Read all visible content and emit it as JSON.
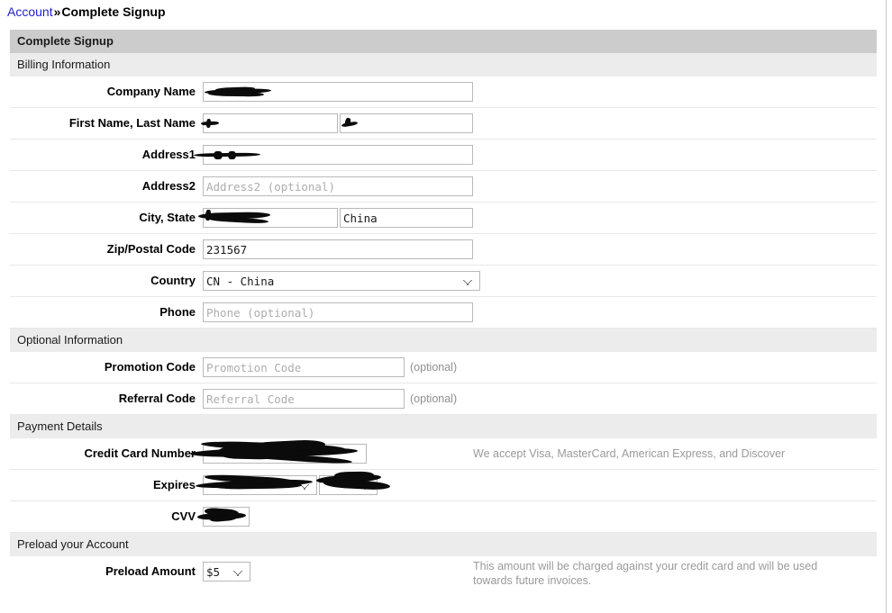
{
  "breadcrumb": {
    "parent": "Account",
    "separator": "»",
    "current": "Complete Signup"
  },
  "panel": {
    "title": "Complete Signup"
  },
  "sections": {
    "billing": "Billing Information",
    "optional": "Optional Information",
    "payment": "Payment Details",
    "preload": "Preload your Account"
  },
  "billing": {
    "company_label": "Company Name",
    "company_value": "",
    "name_label": "First Name, Last Name",
    "first_name_value": "",
    "last_name_value": "",
    "address1_label": "Address1",
    "address1_value": "",
    "address2_label": "Address2",
    "address2_placeholder": "Address2 (optional)",
    "address2_value": "",
    "city_state_label": "City, State",
    "city_value": "",
    "state_value": "China",
    "zip_label": "Zip/Postal Code",
    "zip_value": "231567",
    "country_label": "Country",
    "country_value": "CN - China",
    "phone_label": "Phone",
    "phone_placeholder": "Phone (optional)",
    "phone_value": ""
  },
  "optional": {
    "promotion_label": "Promotion Code",
    "promotion_placeholder": "Promotion Code",
    "promotion_value": "",
    "promotion_hint": "(optional)",
    "referral_label": "Referral Code",
    "referral_placeholder": "Referral Code",
    "referral_value": "",
    "referral_hint": "(optional)"
  },
  "payment": {
    "card_label": "Credit Card Number",
    "card_value": "",
    "card_hint": "We accept Visa, MasterCard, American Express, and Discover",
    "expires_label": "Expires",
    "expires_month_value": "",
    "expires_year_value": "",
    "cvv_label": "CVV",
    "cvv_value": ""
  },
  "preload": {
    "amount_label": "Preload Amount",
    "amount_value": "$5",
    "amount_hint": "This amount will be charged against your credit card and will be used towards future invoices."
  },
  "colors": {
    "link": "#2222cc",
    "panel_title_bg": "#cccccc",
    "section_bg": "#ececec",
    "hint_text": "#9a9a9a",
    "input_border": "#b9b9bd"
  }
}
